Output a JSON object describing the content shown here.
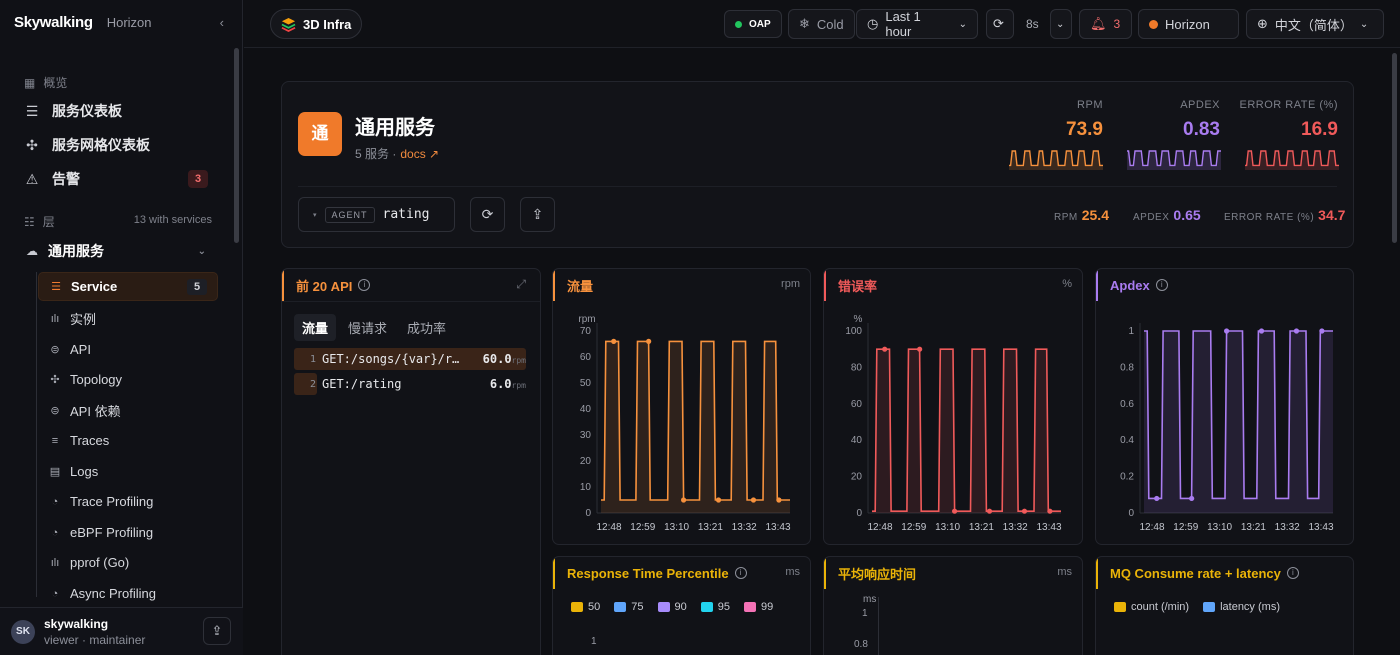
{
  "brand": {
    "logo": "Skywalking",
    "subtitle": "Horizon"
  },
  "sidebar": {
    "overview_label": "概览",
    "nav": [
      {
        "label": "服务仪表板",
        "icon": "dashboard-icon"
      },
      {
        "label": "服务网格仪表板",
        "icon": "mesh-icon"
      },
      {
        "label": "告警",
        "icon": "alert-icon",
        "badge": "3"
      }
    ],
    "layer_label": "层",
    "layer_count": "13 with services",
    "group_label": "通用服务",
    "items": [
      {
        "label": "Service",
        "count": "5",
        "icon": "service-icon"
      },
      {
        "label": "实例",
        "icon": "instance-icon"
      },
      {
        "label": "API",
        "icon": "api-icon"
      },
      {
        "label": "Topology",
        "icon": "topology-icon"
      },
      {
        "label": "API 依赖",
        "icon": "api-dependency-icon"
      },
      {
        "label": "Traces",
        "icon": "traces-icon"
      },
      {
        "label": "Logs",
        "icon": "logs-icon"
      },
      {
        "label": "Trace Profiling",
        "icon": "profiling-icon"
      },
      {
        "label": "eBPF Profiling",
        "icon": "profiling-icon"
      },
      {
        "label": "pprof (Go)",
        "icon": "pprof-icon"
      },
      {
        "label": "Async Profiling",
        "icon": "profiling-icon"
      }
    ],
    "user": {
      "initials": "SK",
      "name": "skywalking",
      "role": "viewer · maintainer"
    }
  },
  "header": {
    "view_label": "3D Infra",
    "oap_label": "OAP",
    "cold_label": "Cold",
    "time_range": "Last 1 hour",
    "refresh_interval": "8s",
    "alert_count": "3",
    "theme_label": "Horizon",
    "language_label": "中文（简体）"
  },
  "service": {
    "tile_char": "通",
    "title": "通用服务",
    "subtitle": "5 服务 ·",
    "docs_label": "docs ↗",
    "agent_tag": "AGENT",
    "agent_name": "rating",
    "kpis": [
      {
        "label": "RPM",
        "value": "73.9",
        "color": "#f6913d"
      },
      {
        "label": "APDEX",
        "value": "0.83",
        "color": "#a97cf0"
      },
      {
        "label": "ERROR RATE (%)",
        "value": "16.9",
        "color": "#f05a5a"
      }
    ],
    "small_kpis": [
      {
        "label": "RPM",
        "value": "25.4",
        "color": "#f6913d"
      },
      {
        "label": "APDEX",
        "value": "0.65",
        "color": "#a97cf0"
      },
      {
        "label": "ERROR RATE (%)",
        "value": "34.7",
        "color": "#f05a5a"
      }
    ]
  },
  "top_api": {
    "title": "前 20 API",
    "tabs": [
      "流量",
      "慢请求",
      "成功率"
    ],
    "unit": "rpm",
    "rows": [
      {
        "rank": "1",
        "name": "GET:/songs/{var}/r…",
        "value": "60.0",
        "share": 1.0
      },
      {
        "rank": "2",
        "name": "GET:/rating",
        "value": "6.0",
        "share": 0.1
      }
    ]
  },
  "panels": {
    "traffic": {
      "title": "流量",
      "unit": "rpm",
      "ylabel": "rpm"
    },
    "error": {
      "title": "错误率",
      "unit": "%",
      "ylabel": "%"
    },
    "apdex": {
      "title": "Apdex"
    },
    "rt": {
      "title": "Response Time Percentile",
      "unit": "ms",
      "legend": [
        "50",
        "75",
        "90",
        "95",
        "99"
      ]
    },
    "avg_rt": {
      "title": "平均响应时间",
      "unit": "ms",
      "ylabel": "ms"
    },
    "mq": {
      "title": "MQ Consume rate + latency",
      "legend": [
        "count (/min)",
        "latency (ms)"
      ]
    }
  },
  "chart_data": [
    {
      "type": "line",
      "title": "流量",
      "ylabel": "rpm",
      "color": "#f6913d",
      "x_ticks": [
        "12:48",
        "12:59",
        "13:10",
        "13:21",
        "13:32",
        "13:43"
      ],
      "ylim": [
        0,
        70
      ],
      "y_ticks": [
        0,
        10,
        20,
        30,
        40,
        50,
        60,
        70
      ],
      "pulses": 6,
      "high": 66,
      "low": 5
    },
    {
      "type": "line",
      "title": "错误率",
      "ylabel": "%",
      "color": "#f05a5a",
      "x_ticks": [
        "12:48",
        "12:59",
        "13:10",
        "13:21",
        "13:32",
        "13:43"
      ],
      "ylim": [
        0,
        100
      ],
      "y_ticks": [
        0,
        20,
        40,
        60,
        80,
        100
      ],
      "pulses": 6,
      "high": 90,
      "low": 1
    },
    {
      "type": "line",
      "title": "Apdex",
      "ylabel": "",
      "color": "#a97cf0",
      "x_ticks": [
        "12:48",
        "12:59",
        "13:10",
        "13:21",
        "13:32",
        "13:43"
      ],
      "ylim": [
        0,
        1
      ],
      "y_ticks": [
        0,
        0.2,
        0.4,
        0.6,
        0.8,
        1
      ],
      "pulses": 6,
      "high": 1,
      "low": 0.08,
      "inverted": true
    },
    {
      "type": "line",
      "title": "Response Time Percentile",
      "ylabel": "",
      "ylim": [
        0,
        1
      ],
      "y_ticks": [
        1
      ],
      "series": [
        {
          "name": "50",
          "color": "#eab308"
        },
        {
          "name": "75",
          "color": "#60a5fa"
        },
        {
          "name": "90",
          "color": "#a78bfa"
        },
        {
          "name": "95",
          "color": "#22d3ee"
        },
        {
          "name": "99",
          "color": "#f472b6"
        }
      ]
    },
    {
      "type": "line",
      "title": "平均响应时间",
      "ylabel": "ms",
      "ylim": [
        0,
        1
      ],
      "y_ticks": [
        1,
        0.8
      ]
    },
    {
      "type": "line",
      "title": "MQ Consume rate + latency",
      "series": [
        {
          "name": "count (/min)",
          "color": "#eab308"
        },
        {
          "name": "latency (ms)",
          "color": "#60a5fa"
        }
      ]
    }
  ]
}
